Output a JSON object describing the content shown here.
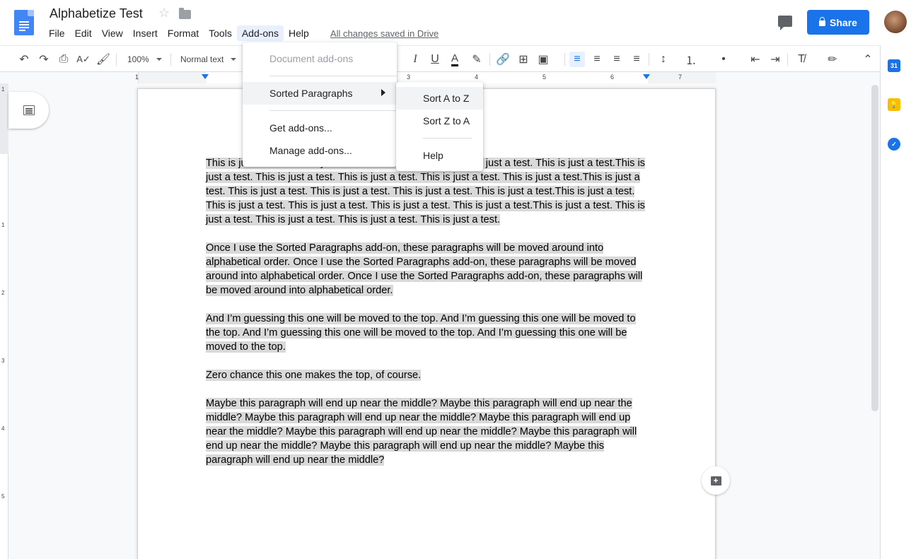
{
  "header": {
    "title": "Alphabetize Test",
    "saved_status": "All changes saved in Drive",
    "share_label": "Share",
    "icons": [
      "docs-logo-icon",
      "star-icon",
      "folder-icon",
      "comment-icon",
      "lock-icon",
      "avatar"
    ]
  },
  "menubar": [
    "File",
    "Edit",
    "View",
    "Insert",
    "Format",
    "Tools",
    "Add-ons",
    "Help"
  ],
  "toolbar": {
    "zoom": "100%",
    "style": "Normal text",
    "italic": "I",
    "underline": "U",
    "text_color": "A"
  },
  "ruler": {
    "numbers": [
      "1",
      "1",
      "2",
      "3",
      "4",
      "5",
      "6",
      "7"
    ],
    "vertical_numbers": [
      "1",
      "1",
      "2",
      "3",
      "4",
      "5"
    ]
  },
  "addons_menu": {
    "title_item": "Document add-ons",
    "items": [
      "Sorted Paragraphs",
      "Get add-ons...",
      "Manage add-ons..."
    ]
  },
  "sorted_paragraphs_menu": {
    "items": [
      "Sort A to Z",
      "Sort Z to A",
      "Help"
    ]
  },
  "document": {
    "paragraphs": [
      "This is just a test. This is just a test. This is just a test. This is just a test. This is just a test.This is just a test. This is just a test. This is just a test. This is just a test. This is just a test.This is just a test. This is just a test. This is just a test. This is just a test. This is just a test.This is just a test. This is just a test. This is just a test. This is just a test. This is just a test.This is just a test. This is just a test. This is just a test. This is just a test. This is just a test.",
      "Once I use the Sorted Paragraphs add-on, these paragraphs will be moved around into alphabetical order. Once I use the Sorted Paragraphs add-on, these paragraphs will be moved around into alphabetical order. Once I use the Sorted Paragraphs add-on, these paragraphs will be moved around into alphabetical order.",
      "And I’m guessing this one will be moved to the top. And I’m guessing this one will be moved to the top. And I’m guessing this one will be moved to the top. And I’m guessing this one will be moved to the top.",
      "Zero chance this one makes the top, of course.",
      "Maybe this paragraph will end up near the middle? Maybe this paragraph will end up near the middle? Maybe this paragraph will end up near the middle? Maybe this paragraph will end up near the middle? Maybe this paragraph will end up near the middle? Maybe this paragraph will end up near the middle? Maybe this paragraph will end up near the middle? Maybe this paragraph will end up near the middle?"
    ]
  },
  "side_panel": {
    "calendar_label": "31",
    "colors": {
      "calendar": "#1a73e8",
      "keep": "#fbbc04",
      "tasks": "#1a73e8"
    }
  },
  "colors": {
    "accent": "#1a73e8",
    "selection": "#d9d9d9"
  }
}
